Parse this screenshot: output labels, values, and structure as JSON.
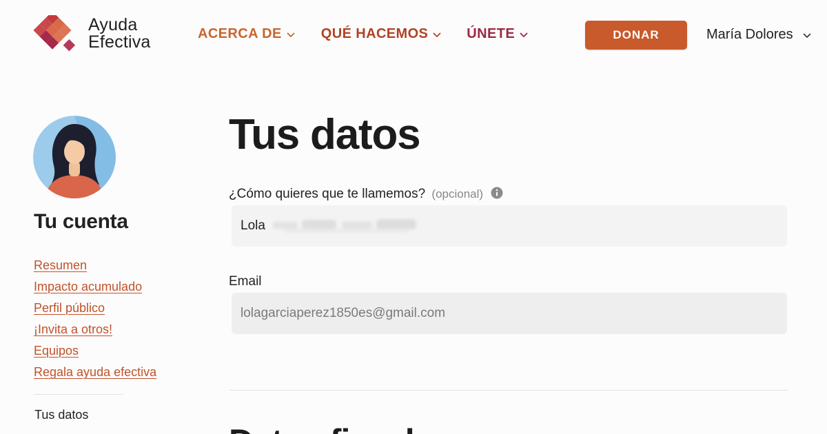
{
  "brand": {
    "line1": "Ayuda",
    "line2": "Efectiva",
    "colors": [
      "#c43a3c",
      "#d9694a",
      "#a6284a",
      "#b23a5c"
    ]
  },
  "nav": {
    "items": [
      {
        "label": "ACERCA DE",
        "icon": "chevron-down-icon",
        "color": "#c8652d"
      },
      {
        "label": "QUÉ HACEMOS",
        "icon": "chevron-down-icon",
        "color": "#b14324"
      },
      {
        "label": "ÚNETE",
        "icon": "chevron-down-icon",
        "color": "#9c2745"
      }
    ],
    "donate_label": "DONAR",
    "donate_color": "#c85a2b",
    "user_name": "María Dolores"
  },
  "sidebar": {
    "avatar_icon": "user-avatar-illustration",
    "title": "Tu cuenta",
    "links": [
      {
        "label": "Resumen"
      },
      {
        "label": "Impacto acumulado"
      },
      {
        "label": "Perfil público"
      },
      {
        "label": "¡Invita a otros!"
      },
      {
        "label": "Equipos"
      },
      {
        "label": "Regala ayuda efectiva"
      }
    ],
    "link_color": "#c0522a",
    "current": "Tus datos"
  },
  "main": {
    "title": "Tus datos",
    "name_field": {
      "label": "¿Cómo quieres que te llamemos?",
      "optional": "(opcional)",
      "info_icon": "info-circle-icon",
      "value": "Lola"
    },
    "email_field": {
      "label": "Email",
      "value": "lolagarciaperez1850es@gmail.com"
    },
    "next_section_title": "Datos fiscales"
  }
}
